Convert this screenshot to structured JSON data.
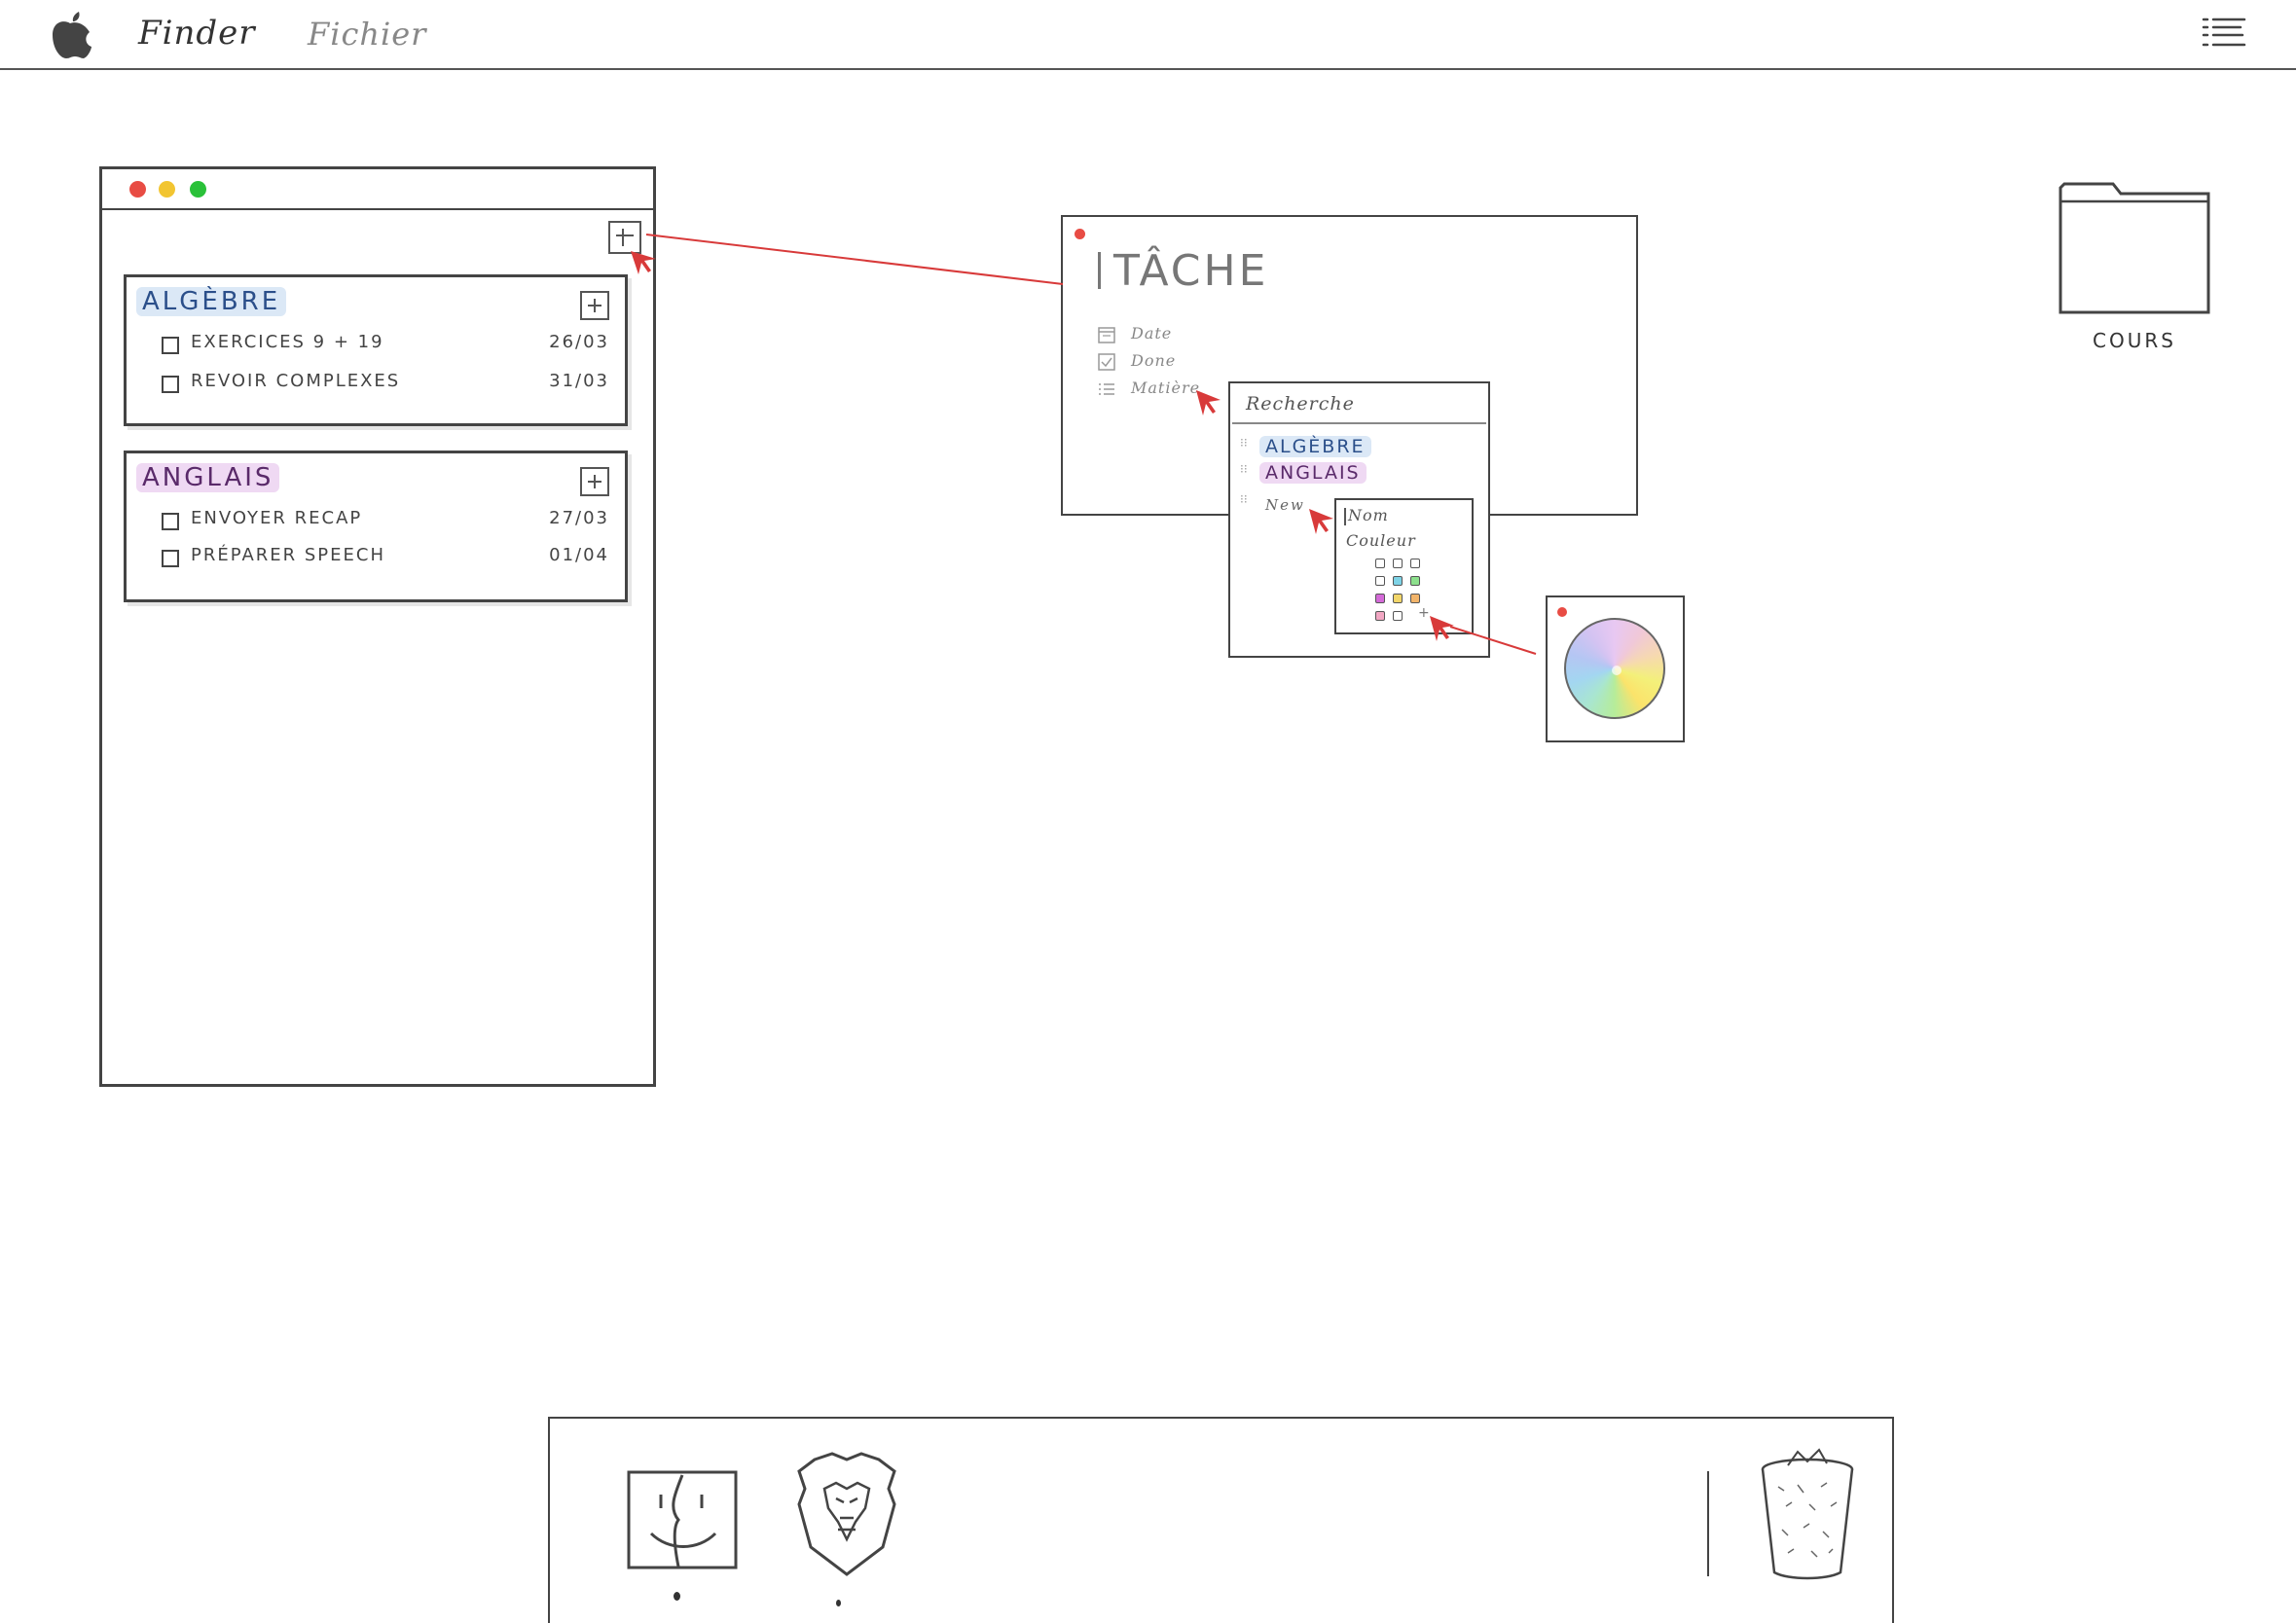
{
  "menubar": {
    "apple_icon": "apple-logo-icon",
    "finder_label": "Finder",
    "file_label": "Fichier",
    "list_icon": "list-menu-icon"
  },
  "app_window": {
    "groups": [
      {
        "name": "ALGÈBRE",
        "color": "#dbe8f6",
        "tasks": [
          {
            "name": "EXERCICES 9 + 19",
            "date": "26/03"
          },
          {
            "name": "REVOIR COMPLEXES",
            "date": "31/03"
          }
        ]
      },
      {
        "name": "ANGLAIS",
        "color": "#efd9f3",
        "tasks": [
          {
            "name": "ENVOYER RECAP",
            "date": "27/03"
          },
          {
            "name": "PRÉPARER SPEECH",
            "date": "01/04"
          }
        ]
      }
    ]
  },
  "task_window": {
    "title": "TÂCHE",
    "properties": [
      {
        "label": "Date",
        "icon": "calendar-icon"
      },
      {
        "label": "Done",
        "icon": "checkbox-icon"
      },
      {
        "label": "Matière",
        "icon": "list-icon"
      }
    ]
  },
  "search_popup": {
    "label": "Recherche",
    "options": [
      "ALGÈBRE",
      "ANGLAIS"
    ],
    "new_label": "New"
  },
  "new_panel": {
    "name_value": "Nom",
    "color_label": "Couleur",
    "swatches": [
      "#ffffff",
      "#ffffff",
      "#ffffff",
      "#ffffff",
      "#7ed3e6",
      "#8ce08c",
      "#d46ad8",
      "#f2d66a",
      "#f2b46a",
      "#f2a7c3",
      "#ffffff"
    ],
    "add_glyph": "+"
  },
  "desktop": {
    "folder_label": "COURS"
  },
  "dock": {
    "apps": [
      "finder-icon",
      "brave-browser-icon",
      "trash-icon"
    ]
  },
  "colors": {
    "annotation_red": "#d83a3a",
    "traffic_close": "#e84c44",
    "traffic_min": "#f2c531",
    "traffic_max": "#2ac139"
  }
}
